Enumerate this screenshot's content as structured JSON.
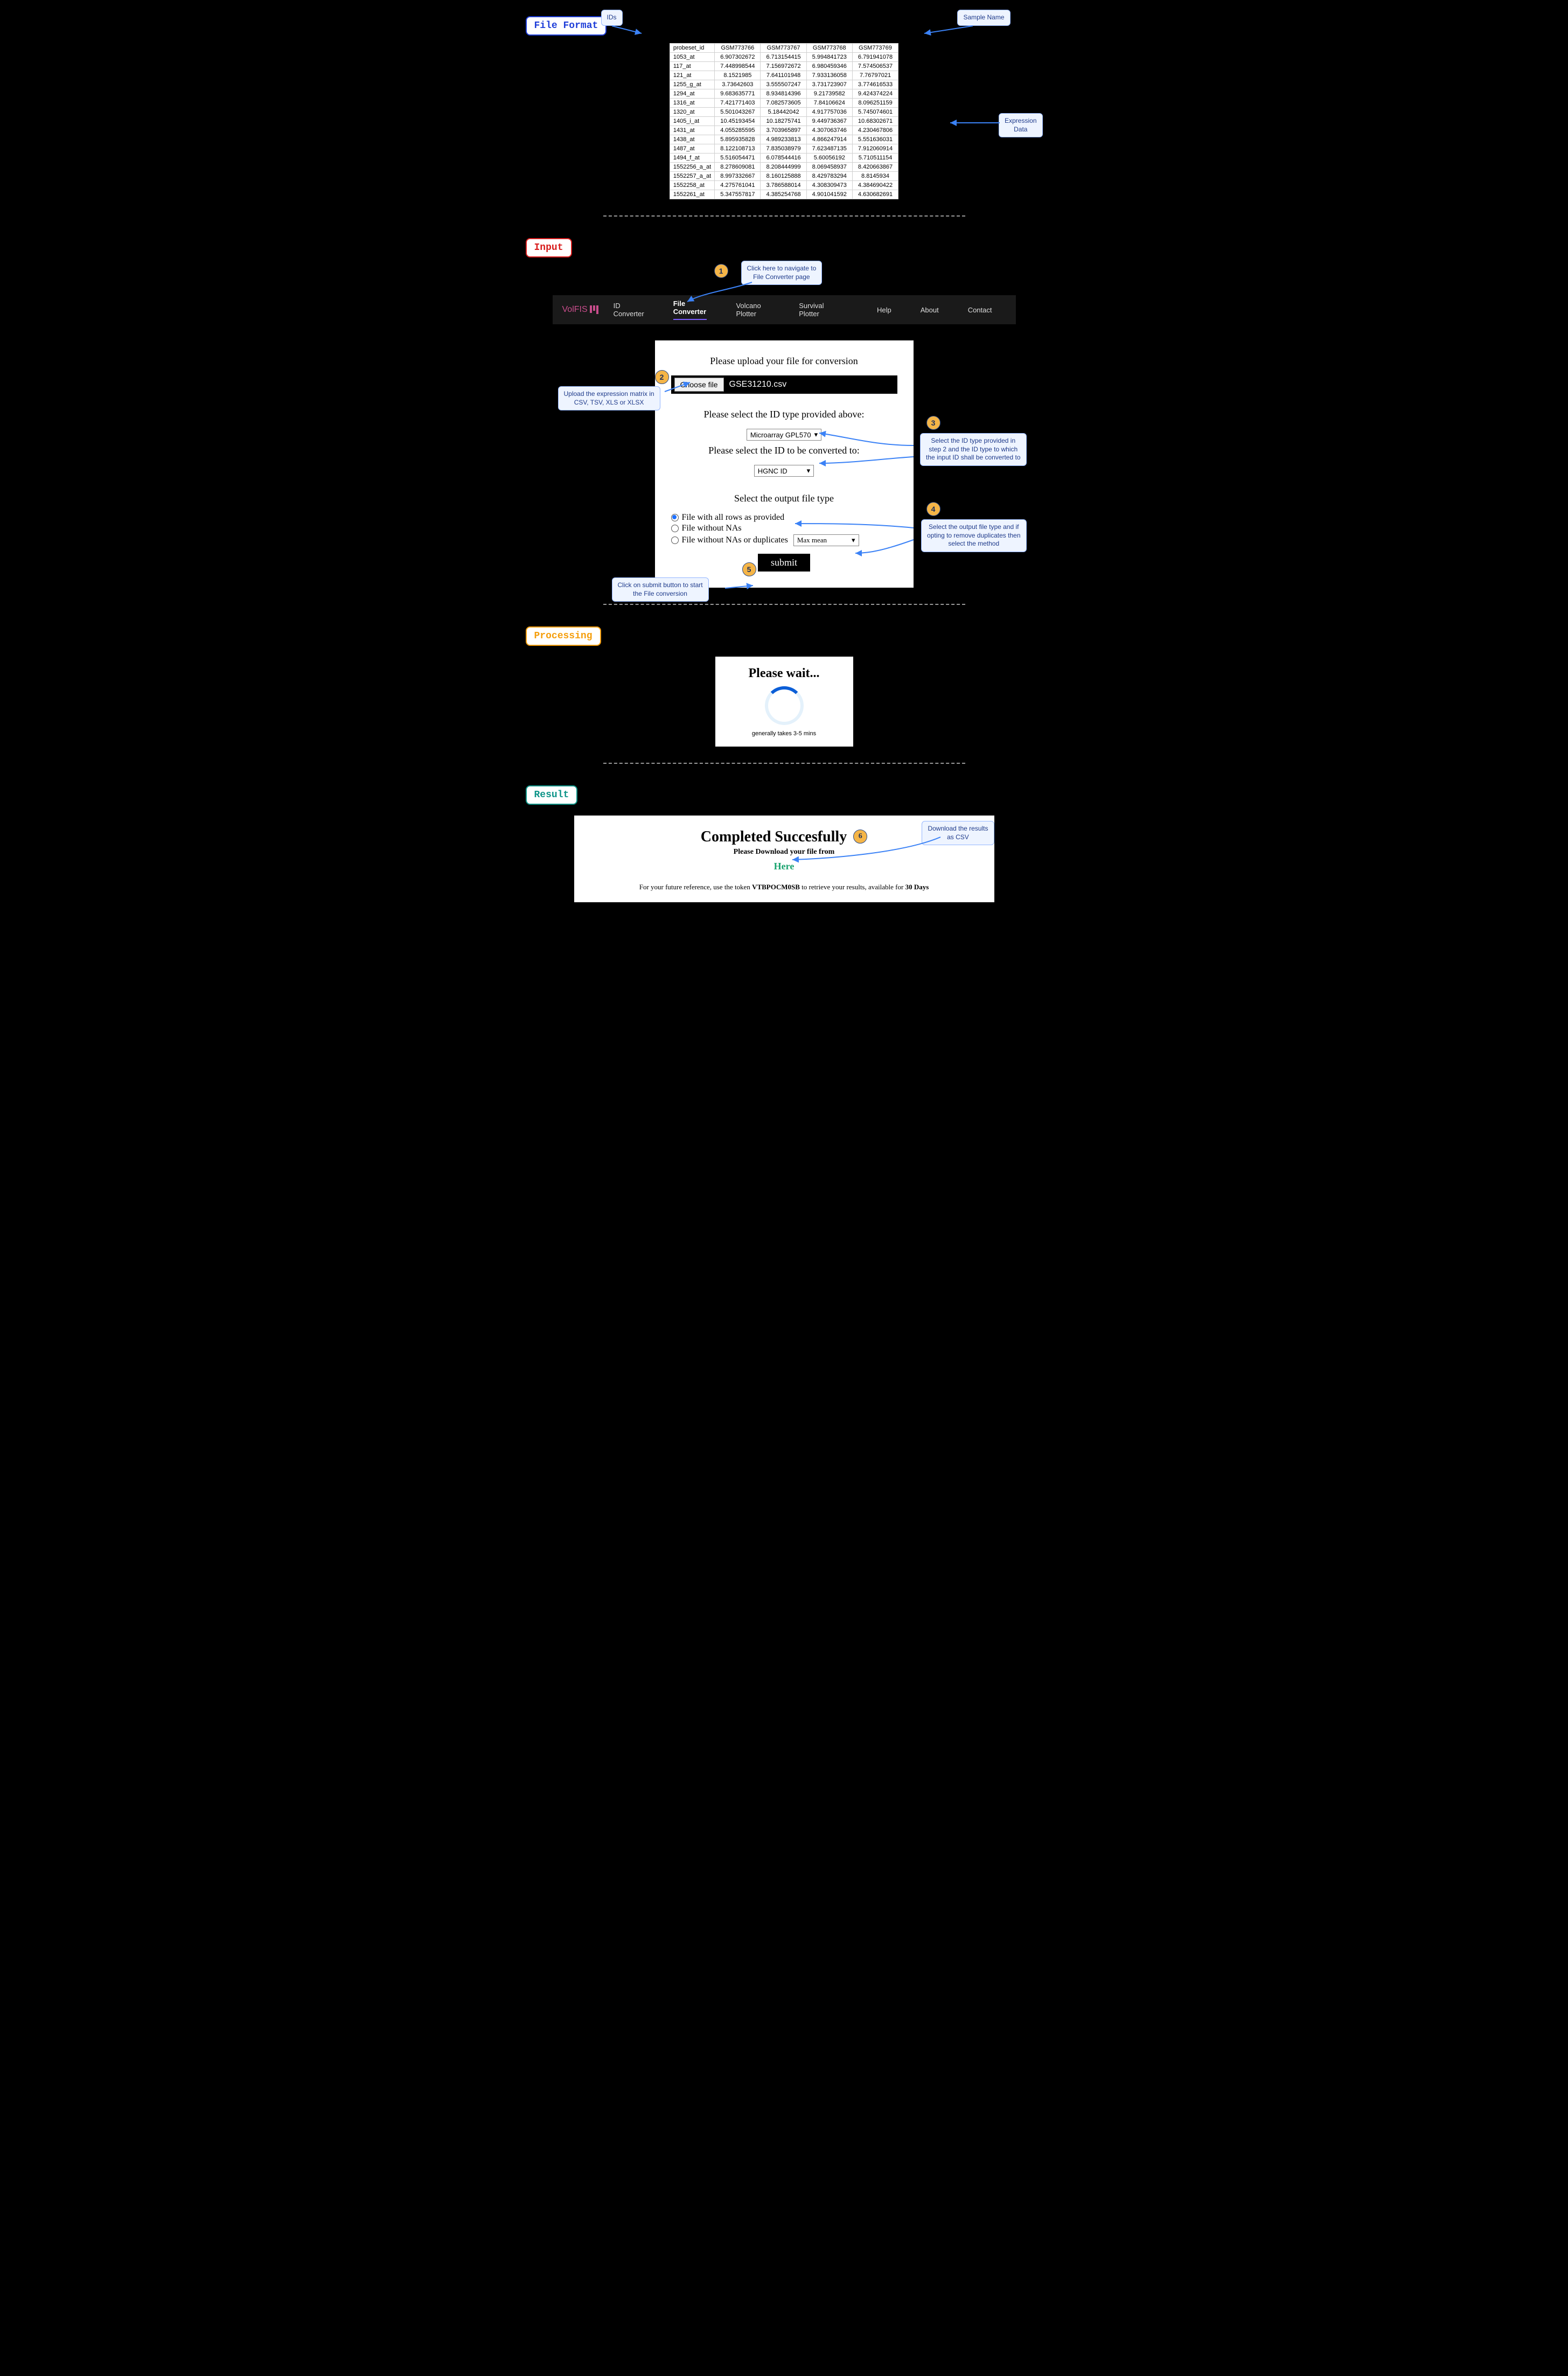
{
  "sections": {
    "file_format": "File Format",
    "input": "Input",
    "processing": "Processing",
    "result": "Result"
  },
  "callouts": {
    "ids": "IDs",
    "sample_name": "Sample Name",
    "expression_data": "Expression\nData",
    "c1": "Click here to navigate to\nFile Converter page",
    "c2": "Upload the expression matrix in\nCSV, TSV, XLS or XLSX",
    "c3": "Select the ID type provided in\nstep 2 and the ID type to which\nthe input ID shall be converted to",
    "c4": "Select the output file type and if\nopting to remove duplicates then\nselect the method",
    "c5": "Click on submit button to start\nthe File conversion",
    "c6": "Download the results\nas CSV"
  },
  "table": {
    "header": [
      "probeset_id",
      "GSM773766",
      "GSM773767",
      "GSM773768",
      "GSM773769"
    ],
    "rows": [
      [
        "1053_at",
        "6.907302672",
        "6.713154415",
        "5.994841723",
        "6.791941078"
      ],
      [
        "117_at",
        "7.448998544",
        "7.156972672",
        "6.980459346",
        "7.574506537"
      ],
      [
        "121_at",
        "8.1521985",
        "7.641101948",
        "7.933136058",
        "7.76797021"
      ],
      [
        "1255_g_at",
        "3.73642603",
        "3.555507247",
        "3.731723907",
        "3.774616533"
      ],
      [
        "1294_at",
        "9.683635771",
        "8.934814396",
        "9.21739582",
        "9.424374224"
      ],
      [
        "1316_at",
        "7.421771403",
        "7.082573605",
        "7.84106624",
        "8.096251159"
      ],
      [
        "1320_at",
        "5.501043267",
        "5.18442042",
        "4.917757036",
        "5.745074601"
      ],
      [
        "1405_i_at",
        "10.45193454",
        "10.18275741",
        "9.449736367",
        "10.68302671"
      ],
      [
        "1431_at",
        "4.055285595",
        "3.703965897",
        "4.307063746",
        "4.230467806"
      ],
      [
        "1438_at",
        "5.895935828",
        "4.989233813",
        "4.866247914",
        "5.551636031"
      ],
      [
        "1487_at",
        "8.122108713",
        "7.835038979",
        "7.623487135",
        "7.912060914"
      ],
      [
        "1494_f_at",
        "5.516054471",
        "6.078544416",
        "5.60056192",
        "5.710511154"
      ],
      [
        "1552256_a_at",
        "8.278609081",
        "8.208444999",
        "8.069458937",
        "8.420663867"
      ],
      [
        "1552257_a_at",
        "8.997332667",
        "8.160125888",
        "8.429783294",
        "8.8145934"
      ],
      [
        "1552258_at",
        "4.275761041",
        "3.786588014",
        "4.308309473",
        "4.384690422"
      ],
      [
        "1552261_at",
        "5.347557817",
        "4.385254768",
        "4.901041592",
        "4.630682691"
      ]
    ]
  },
  "nav": {
    "logo": "VolFIS",
    "items": [
      "ID Converter",
      "File Converter",
      "Volcano Plotter",
      "Survival Plotter",
      "Help",
      "About",
      "Contact"
    ],
    "active_index": 1
  },
  "panel": {
    "h_upload": "Please upload your file for conversion",
    "choose_btn": "Choose file",
    "filename": "GSE31210.csv",
    "h_idtype": "Please select the ID type provided above:",
    "sel_idtype": "Microarray GPL570",
    "h_convert": "Please select the ID to be converted to:",
    "sel_convert": "HGNC ID",
    "h_output": "Select the output file type",
    "radios": [
      "File with all rows as provided",
      "File without NAs",
      "File without NAs or duplicates"
    ],
    "dup_method": "Max mean",
    "submit": "submit"
  },
  "wait": {
    "title": "Please wait...",
    "sub": "generally takes 3-5 mins"
  },
  "result": {
    "title": "Completed Succesfully",
    "sub": "Please Download your file from",
    "link": "Here",
    "note_pre": "For your future reference, use the token ",
    "token": "VTBPOCM0SB",
    "note_mid": " to retrieve your results, available for ",
    "days": "30 Days"
  }
}
